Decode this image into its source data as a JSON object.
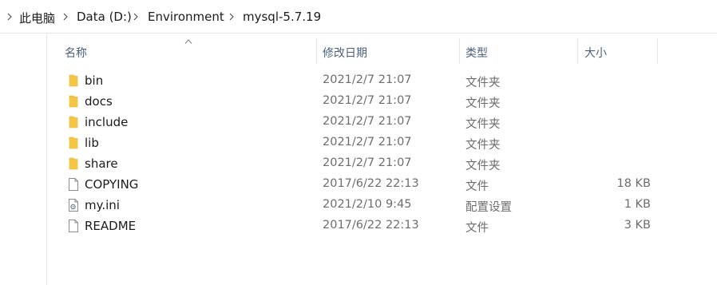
{
  "breadcrumb": {
    "items": [
      {
        "label": "此电脑"
      },
      {
        "label": "Data (D:)"
      },
      {
        "label": "Environment"
      },
      {
        "label": "mysql-5.7.19"
      }
    ]
  },
  "columns": {
    "name": "名称",
    "date": "修改日期",
    "type": "类型",
    "size": "大小"
  },
  "files": [
    {
      "name": "bin",
      "date": "2021/2/7 21:07",
      "type": "文件夹",
      "size": "",
      "icon": "folder-icon"
    },
    {
      "name": "docs",
      "date": "2021/2/7 21:07",
      "type": "文件夹",
      "size": "",
      "icon": "folder-icon"
    },
    {
      "name": "include",
      "date": "2021/2/7 21:07",
      "type": "文件夹",
      "size": "",
      "icon": "folder-icon"
    },
    {
      "name": "lib",
      "date": "2021/2/7 21:07",
      "type": "文件夹",
      "size": "",
      "icon": "folder-icon"
    },
    {
      "name": "share",
      "date": "2021/2/7 21:07",
      "type": "文件夹",
      "size": "",
      "icon": "folder-icon"
    },
    {
      "name": "COPYING",
      "date": "2017/6/22 22:13",
      "type": "文件",
      "size": "18 KB",
      "icon": "file-icon"
    },
    {
      "name": "my.ini",
      "date": "2021/2/10 9:45",
      "type": "配置设置",
      "size": "1 KB",
      "icon": "settings-file-icon"
    },
    {
      "name": "README",
      "date": "2017/6/22 22:13",
      "type": "文件",
      "size": "3 KB",
      "icon": "file-icon"
    }
  ],
  "colors": {
    "folder": "#f5c642",
    "header_text": "#4c607a",
    "secondary_text": "#6d6d6d"
  }
}
